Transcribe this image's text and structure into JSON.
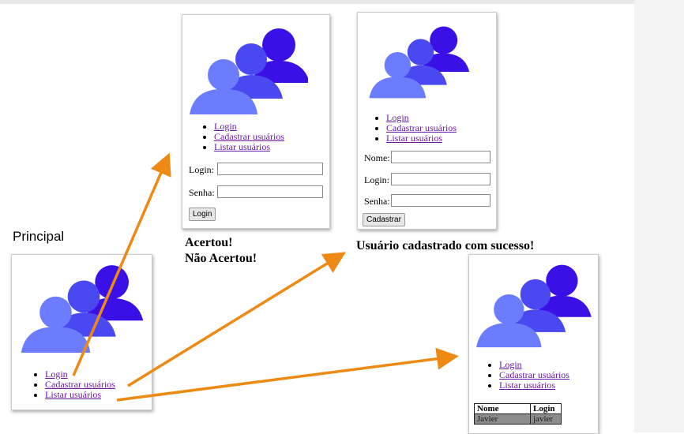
{
  "principal_label": "Principal",
  "menu": [
    "Login",
    "Cadastrar usuários",
    "Listar usuários"
  ],
  "login_panel": {
    "login_label": "Login:",
    "senha_label": "Senha:",
    "button": "Login"
  },
  "login_messages": [
    "Acertou!",
    "Não Acertou!"
  ],
  "cadastro_panel": {
    "nome_label": "Nome:",
    "login_label": "Login:",
    "senha_label": "Senha:",
    "button": "Cadastrar"
  },
  "cadastro_message": "Usuário cadastrado com sucesso!",
  "list_panel": {
    "columns": [
      "Nome",
      "Login"
    ],
    "rows": [
      [
        "Javier",
        "javier"
      ]
    ]
  },
  "colors": {
    "arrow": "#ee8a14",
    "logo_front": "#6b7cff",
    "logo_mid": "#4a48f0",
    "logo_back": "#3a10e6",
    "link": "#6b17a8"
  },
  "icons": [
    "users-logo-icon"
  ]
}
